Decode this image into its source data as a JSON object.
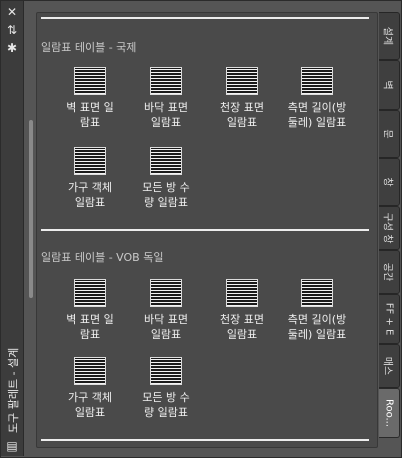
{
  "palette": {
    "title": "도구 팔레트 - 설계",
    "icons": {
      "close": "close-icon",
      "autohide": "autohide-icon",
      "properties": "properties-icon",
      "menu": "menu-icon"
    }
  },
  "sections": [
    {
      "title": "일람표 테이블 - 국제",
      "tools": [
        {
          "label": "벽 표면 일\n람표"
        },
        {
          "label": "바닥 표면\n일람표"
        },
        {
          "label": "천장 표면\n일람표"
        },
        {
          "label": "측면 길이(방\n둘레) 일람표"
        },
        {
          "label": "가구 객체\n일람표"
        },
        {
          "label": "모든 방 수\n량 일람표"
        }
      ]
    },
    {
      "title": "일람표 테이블 - VOB 독일",
      "tools": [
        {
          "label": "벽 표면 일\n람표"
        },
        {
          "label": "바닥 표면\n일람표"
        },
        {
          "label": "천장 표면\n일람표"
        },
        {
          "label": "측면 길이(방\n둘레) 일람표"
        },
        {
          "label": "가구 객체\n일람표"
        },
        {
          "label": "모든 방 수\n량 일람표"
        }
      ]
    }
  ],
  "tabs": [
    {
      "label": "설계"
    },
    {
      "label": "벽"
    },
    {
      "label": "문"
    },
    {
      "label": "창"
    },
    {
      "label": "구성 창"
    },
    {
      "label": "공간"
    },
    {
      "label": "FF + E"
    },
    {
      "label": "매스"
    },
    {
      "label": "Roo..."
    }
  ]
}
